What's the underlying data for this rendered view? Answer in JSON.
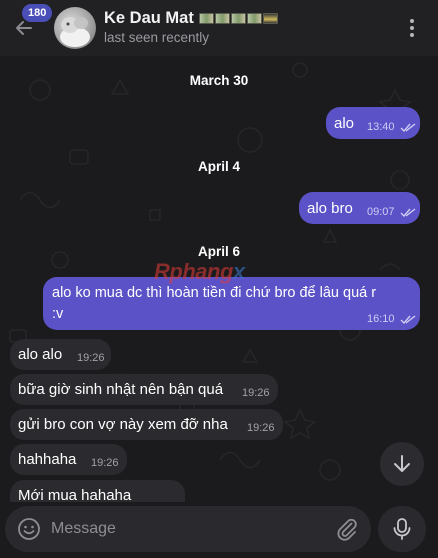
{
  "header": {
    "unread_badge": "180",
    "contact_name": "Ke Dau Mat",
    "status": "last seen recently"
  },
  "dates": {
    "d1": "March 30",
    "d2": "April 4",
    "d3": "April 6"
  },
  "messages": [
    {
      "direction": "out",
      "text": "alo",
      "time": "13:40"
    },
    {
      "direction": "out",
      "text": "alo bro",
      "time": "09:07"
    },
    {
      "direction": "out",
      "text": "alo ko mua dc thì hoàn tiền đi chứ bro để lâu quá r :v",
      "line1": "alo ko mua dc thì hoàn tiền đi chứ bro để lâu quá r",
      "line2": ":v",
      "time": "16:10"
    },
    {
      "direction": "in",
      "text": "alo alo",
      "time": "19:26"
    },
    {
      "direction": "in",
      "text": "bữa giờ sinh nhật nên bận quá",
      "time": "19:26"
    },
    {
      "direction": "in",
      "text": "gửi bro con vợ này xem đỡ nha",
      "time": "19:26"
    },
    {
      "direction": "in",
      "text": "hahhaha",
      "time": "19:26"
    },
    {
      "direction": "in",
      "text": "Mới mua hahaha",
      "time": ""
    }
  ],
  "watermark": {
    "part1": "Rphang",
    "part2": "x"
  },
  "composer": {
    "placeholder": "Message"
  },
  "colors": {
    "outgoing_bubble": "#5b52c7",
    "incoming_bubble": "#2b2b2f",
    "background": "#1b1b1d",
    "badge": "#4a4fb8"
  },
  "icons": [
    "back-arrow-icon",
    "more-vertical-icon",
    "double-check-icon",
    "chevron-down-icon",
    "emoji-icon",
    "paperclip-icon",
    "microphone-icon"
  ]
}
